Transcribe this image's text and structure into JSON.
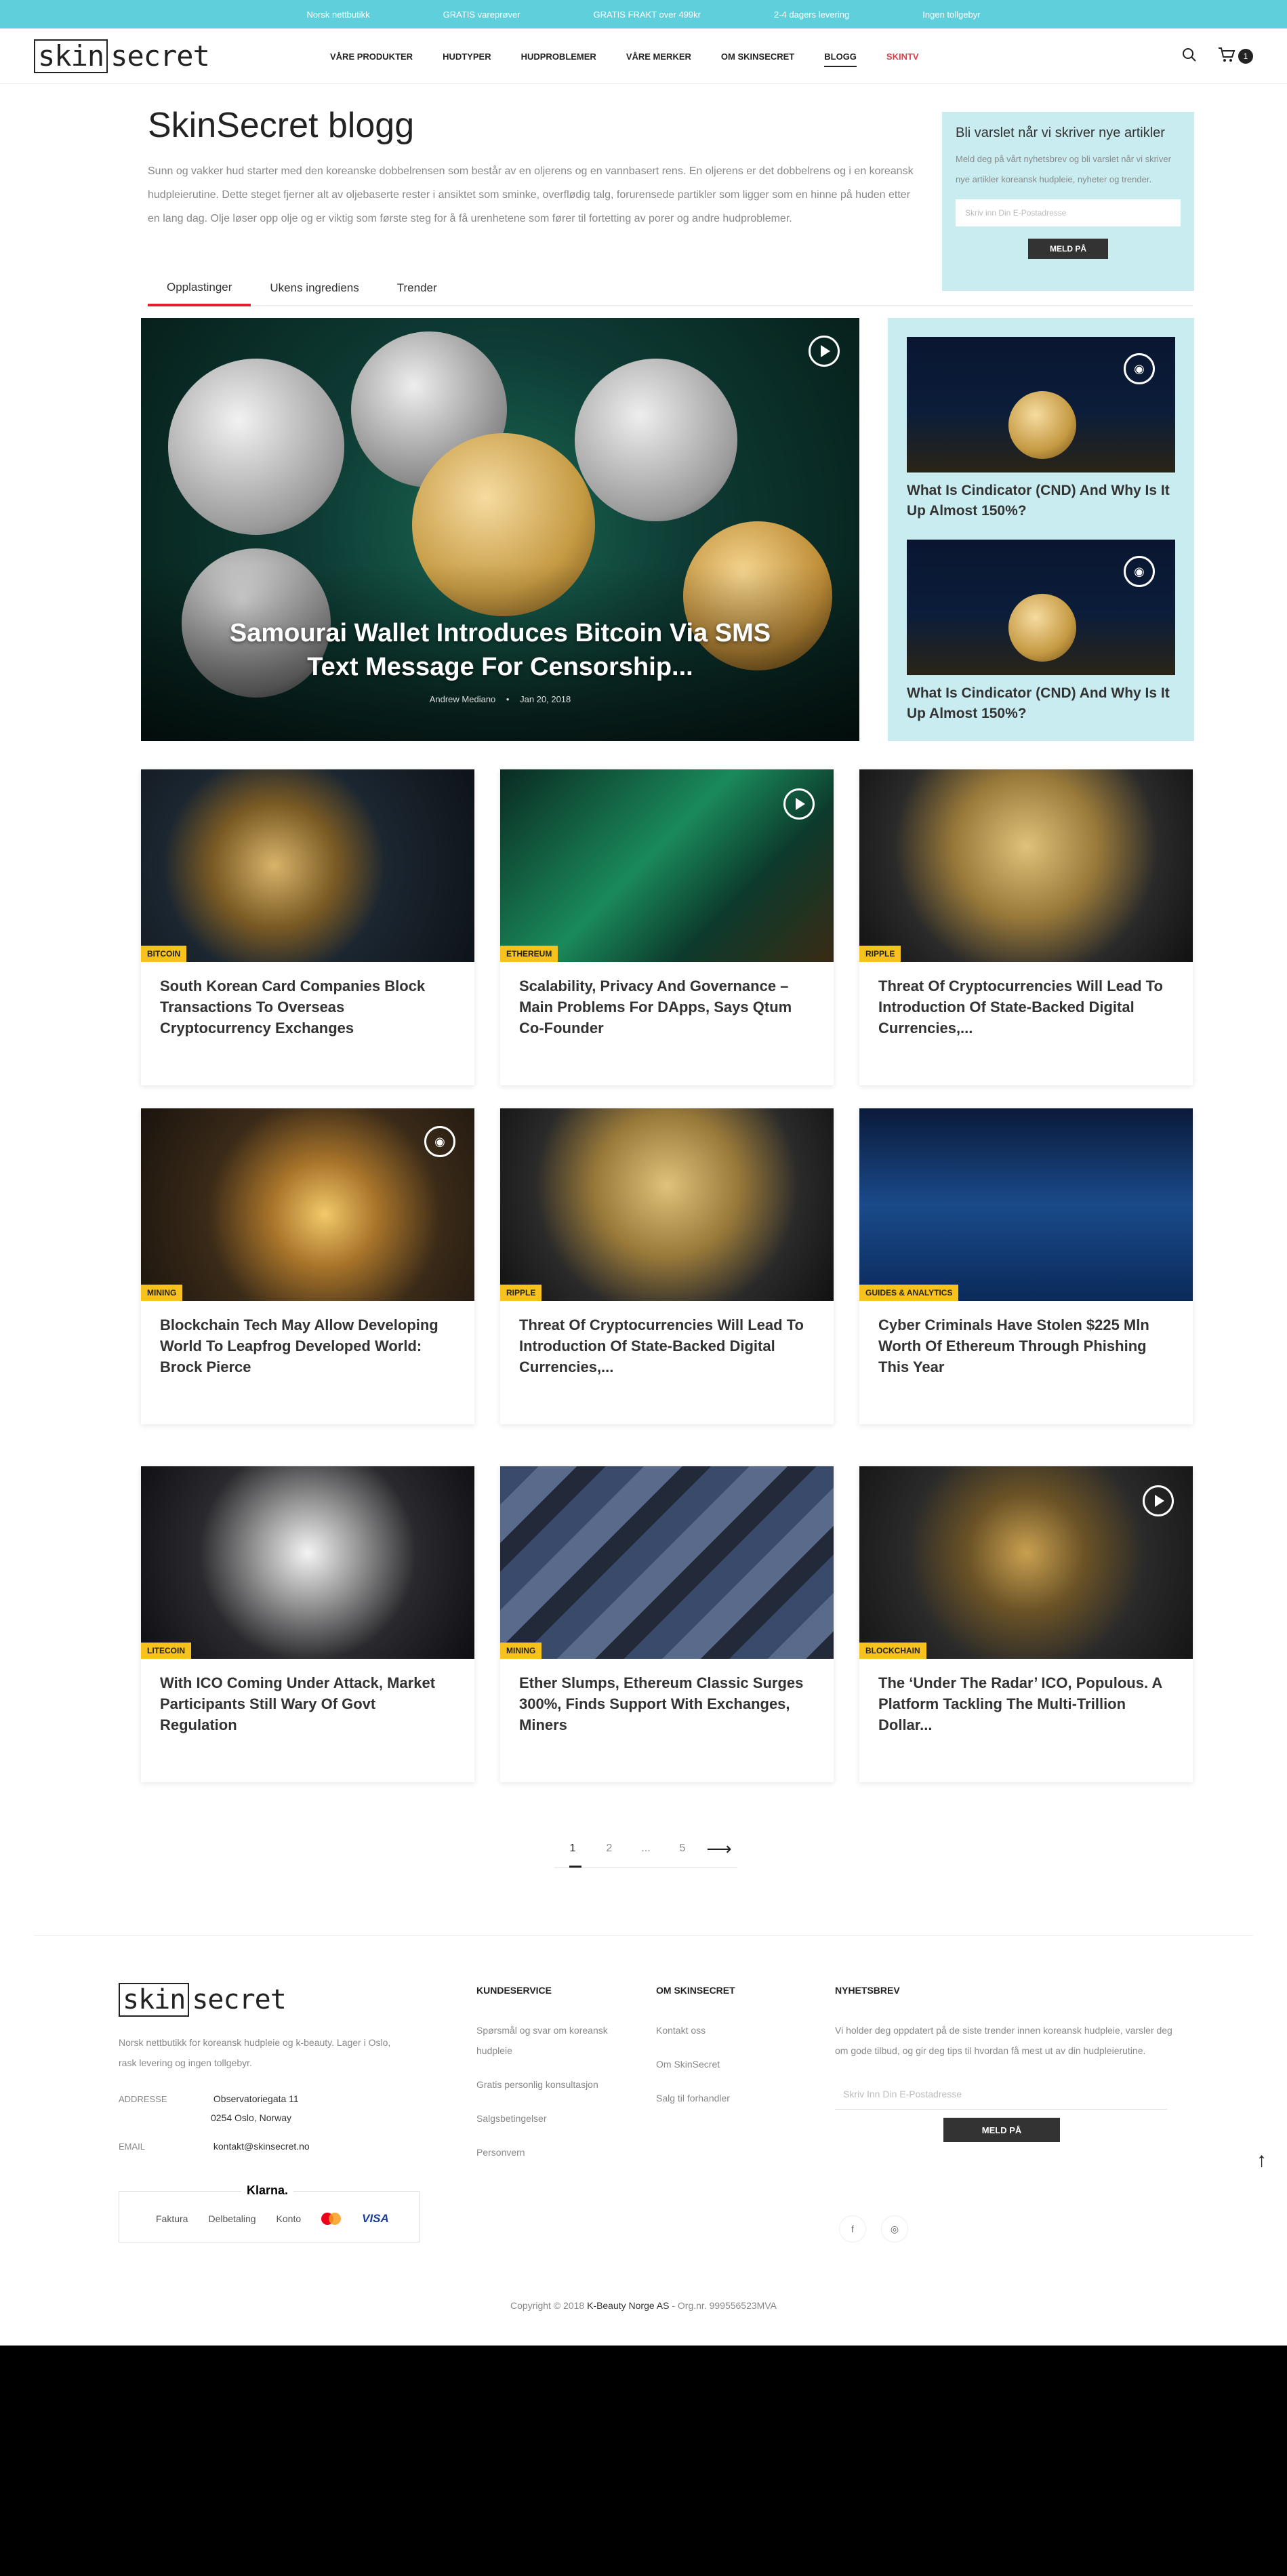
{
  "topbar": [
    "Norsk nettbutikk",
    "GRATIS vareprøver",
    "GRATIS FRAKT over 499kr",
    "2-4 dagers levering",
    "Ingen tollgebyr"
  ],
  "logo": {
    "part1": "skin",
    "part2": "secret"
  },
  "nav": [
    "VÅRE PRODUKTER",
    "HUDTYPER",
    "HUDPROBLEMER",
    "VÅRE MERKER",
    "OM SKINSECRET",
    "BLOGG",
    "SKINTV"
  ],
  "cart_count": "1",
  "intro": {
    "title": "SkinSecret blogg",
    "text": "Sunn og vakker hud starter med den koreanske dobbelrensen som består av en oljerens og en vannbasert rens. En oljerens er det dobbelrens og i en koreansk hudpleierutine. Dette steget fjerner alt av oljebaserte rester i ansiktet som sminke, overflødig talg, forurensede partikler som ligger som en hinne på huden etter en lang dag. Olje løser opp olje og er viktig som første steg for å få urenhetene som fører til fortetting av porer og andre hudproblemer."
  },
  "tabs": [
    "Opplastinger",
    "Ukens ingrediens",
    "Trender"
  ],
  "newsletter": {
    "title": "Bli varslet når vi skriver nye artikler",
    "text": "Meld deg på vårt nyhetsbrev og bli varslet når vi skriver nye artikler koreansk hudpleie, nyheter og trender.",
    "placeholder": "Skriv inn Din E-Postadresse",
    "button": "MELD PÅ"
  },
  "hero": {
    "title": "Samourai Wallet Introduces Bitcoin Via SMS Text Message For Censorship...",
    "author": "Andrew Mediano",
    "date": "Jan 20, 2018"
  },
  "side": [
    {
      "title": "What Is Cindicator (CND) And Why Is It Up Almost 150%?"
    },
    {
      "title": "What Is Cindicator (CND) And Why Is It Up Almost 150%?"
    }
  ],
  "cards": [
    {
      "tag": "BITCOIN",
      "title": "South Korean Card Companies Block Transactions To Overseas Cryptocurrency Exchanges"
    },
    {
      "tag": "ETHEREUM",
      "title": "Scalability, Privacy And Governance – Main Problems For DApps, Says Qtum Co-Founder"
    },
    {
      "tag": "RIPPLE",
      "title": "Threat Of Cryptocurrencies Will Lead To Introduction Of State-Backed Digital Currencies,..."
    },
    {
      "tag": "MINING",
      "title": "Blockchain Tech May Allow Developing World To Leapfrog Developed World: Brock Pierce"
    },
    {
      "tag": "RIPPLE",
      "title": "Threat Of Cryptocurrencies Will Lead To Introduction Of State-Backed Digital Currencies,..."
    },
    {
      "tag": "GUIDES & ANALYTICS",
      "title": "Cyber Criminals Have Stolen $225 Mln Worth Of Ethereum Through Phishing This Year"
    },
    {
      "tag": "LITECOIN",
      "title": "With ICO Coming Under Attack, Market Participants Still Wary Of Govt Regulation"
    },
    {
      "tag": "MINING",
      "title": "Ether Slumps, Ethereum Classic Surges 300%, Finds Support With Exchanges, Miners"
    },
    {
      "tag": "BLOCKCHAIN",
      "title": "The ‘Under The Radar’ ICO, Populous. A Platform Tackling The Multi-Trillion Dollar..."
    }
  ],
  "pagination": [
    "1",
    "2",
    "...",
    "5",
    "⟶"
  ],
  "footer": {
    "description": "Norsk nettbutikk for koreansk hudpleie og k-beauty. Lager i Oslo, rask levering og ingen tollgebyr.",
    "address_label": "ADDRESSE",
    "address_line1": "Observatoriegata 11",
    "address_line2": "0254 Oslo, Norway",
    "email_label": "EMAIL",
    "email": "kontakt@skinsecret.no",
    "klarna": "Klarna.",
    "payments": [
      "Faktura",
      "Delbetaling",
      "Konto"
    ],
    "visa": "VISA",
    "col1_title": "KUNDESERVICE",
    "col1": [
      "Spørsmål og svar om koreansk hudpleie",
      "Gratis personlig konsultasjon",
      "Salgsbetingelser",
      "Personvern"
    ],
    "col2_title": "OM SKINSECRET",
    "col2": [
      "Kontakt oss",
      "Om SkinSecret",
      "Salg til forhandler"
    ],
    "col3_title": "NYHETSBREV",
    "col3_text": "Vi holder deg oppdatert på de siste trender innen koreansk hudpleie, varsler deg om gode tilbud, og gir deg tips til hvordan få mest ut av din hudpleierutine.",
    "col3_placeholder": "Skriv Inn Din E-Postadresse",
    "col3_button": "MELD PÅ",
    "social": [
      "f",
      "◎"
    ],
    "copyright_pre": "Copyright © 2018",
    "copyright_company": "K-Beauty Norge AS",
    "copyright_post": "- Org.nr. 999556523MVA"
  }
}
